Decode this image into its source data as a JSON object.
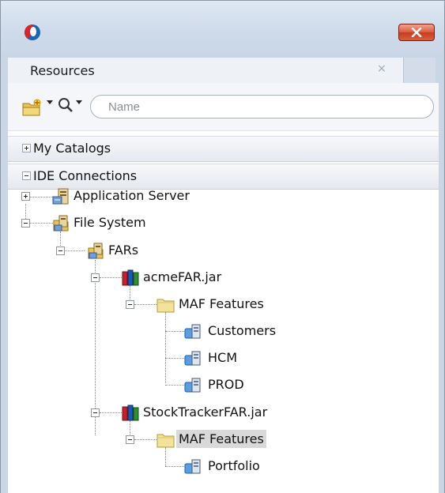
{
  "window": {
    "tab": {
      "label": "Resources",
      "close_glyph": "×"
    },
    "close_glyph": "✕"
  },
  "toolbar": {
    "new_icon": "new-connection-icon",
    "search_icon": "search-icon",
    "search_placeholder": "Name"
  },
  "categories": {
    "my_catalogs": "My Catalogs",
    "ide_connections": "IDE Connections"
  },
  "tree": {
    "application_server": "Application Server",
    "file_system": "File System",
    "fars": "FARs",
    "acme_jar": "acmeFAR.jar",
    "acme_features": "MAF Features",
    "customers": "Customers",
    "hcm": "HCM",
    "prod": "PROD",
    "stock_jar": "StockTrackerFAR.jar",
    "stock_features": "MAF Features",
    "portfolio": "Portfolio"
  },
  "colors": {
    "title_bar": "#cfdbea",
    "close_button": "#d95a3c",
    "selection": "#d9d9d9",
    "folder": "#f3e29a"
  }
}
